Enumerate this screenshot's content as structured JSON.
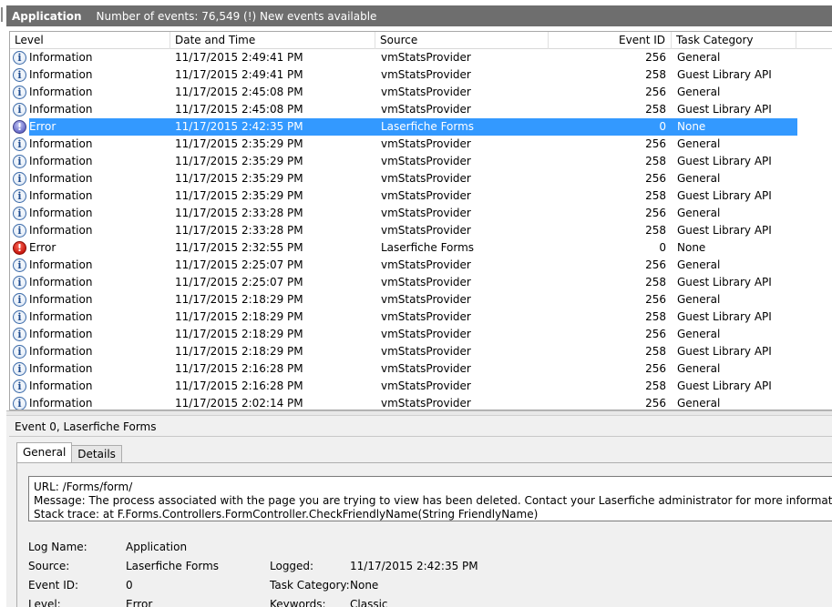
{
  "title": {
    "app": "Application",
    "info": "Number of events: 76,549 (!) New events available"
  },
  "columns": {
    "level": "Level",
    "date": "Date and Time",
    "source": "Source",
    "event_id": "Event ID",
    "task": "Task Category"
  },
  "rows": [
    {
      "level": "Information",
      "icon": "info-icon",
      "date": "11/17/2015 2:49:41 PM",
      "source": "vmStatsProvider",
      "id": "256",
      "task": "General"
    },
    {
      "level": "Information",
      "icon": "info-icon",
      "date": "11/17/2015 2:49:41 PM",
      "source": "vmStatsProvider",
      "id": "258",
      "task": "Guest Library API"
    },
    {
      "level": "Information",
      "icon": "info-icon",
      "date": "11/17/2015 2:45:08 PM",
      "source": "vmStatsProvider",
      "id": "256",
      "task": "General"
    },
    {
      "level": "Information",
      "icon": "info-icon",
      "date": "11/17/2015 2:45:08 PM",
      "source": "vmStatsProvider",
      "id": "258",
      "task": "Guest Library API"
    },
    {
      "level": "Error",
      "icon": "error-icon",
      "date": "11/17/2015 2:42:35 PM",
      "source": "Laserfiche Forms",
      "id": "0",
      "task": "None",
      "selected": true
    },
    {
      "level": "Information",
      "icon": "info-icon",
      "date": "11/17/2015 2:35:29 PM",
      "source": "vmStatsProvider",
      "id": "256",
      "task": "General"
    },
    {
      "level": "Information",
      "icon": "info-icon",
      "date": "11/17/2015 2:35:29 PM",
      "source": "vmStatsProvider",
      "id": "258",
      "task": "Guest Library API"
    },
    {
      "level": "Information",
      "icon": "info-icon",
      "date": "11/17/2015 2:35:29 PM",
      "source": "vmStatsProvider",
      "id": "256",
      "task": "General"
    },
    {
      "level": "Information",
      "icon": "info-icon",
      "date": "11/17/2015 2:35:29 PM",
      "source": "vmStatsProvider",
      "id": "258",
      "task": "Guest Library API"
    },
    {
      "level": "Information",
      "icon": "info-icon",
      "date": "11/17/2015 2:33:28 PM",
      "source": "vmStatsProvider",
      "id": "256",
      "task": "General"
    },
    {
      "level": "Information",
      "icon": "info-icon",
      "date": "11/17/2015 2:33:28 PM",
      "source": "vmStatsProvider",
      "id": "258",
      "task": "Guest Library API"
    },
    {
      "level": "Error",
      "icon": "error-icon",
      "date": "11/17/2015 2:32:55 PM",
      "source": "Laserfiche Forms",
      "id": "0",
      "task": "None"
    },
    {
      "level": "Information",
      "icon": "info-icon",
      "date": "11/17/2015 2:25:07 PM",
      "source": "vmStatsProvider",
      "id": "256",
      "task": "General"
    },
    {
      "level": "Information",
      "icon": "info-icon",
      "date": "11/17/2015 2:25:07 PM",
      "source": "vmStatsProvider",
      "id": "258",
      "task": "Guest Library API"
    },
    {
      "level": "Information",
      "icon": "info-icon",
      "date": "11/17/2015 2:18:29 PM",
      "source": "vmStatsProvider",
      "id": "256",
      "task": "General"
    },
    {
      "level": "Information",
      "icon": "info-icon",
      "date": "11/17/2015 2:18:29 PM",
      "source": "vmStatsProvider",
      "id": "258",
      "task": "Guest Library API"
    },
    {
      "level": "Information",
      "icon": "info-icon",
      "date": "11/17/2015 2:18:29 PM",
      "source": "vmStatsProvider",
      "id": "256",
      "task": "General"
    },
    {
      "level": "Information",
      "icon": "info-icon",
      "date": "11/17/2015 2:18:29 PM",
      "source": "vmStatsProvider",
      "id": "258",
      "task": "Guest Library API"
    },
    {
      "level": "Information",
      "icon": "info-icon",
      "date": "11/17/2015 2:16:28 PM",
      "source": "vmStatsProvider",
      "id": "256",
      "task": "General"
    },
    {
      "level": "Information",
      "icon": "info-icon",
      "date": "11/17/2015 2:16:28 PM",
      "source": "vmStatsProvider",
      "id": "258",
      "task": "Guest Library API"
    },
    {
      "level": "Information",
      "icon": "info-icon",
      "date": "11/17/2015 2:02:14 PM",
      "source": "vmStatsProvider",
      "id": "256",
      "task": "General"
    }
  ],
  "detail": {
    "title": "Event 0, Laserfiche Forms",
    "tabs": {
      "general": "General",
      "details": "Details"
    },
    "message_lines": [
      "URL: /Forms/form/",
      "Message: The process associated with the page you are trying to view has been deleted. Contact your Laserfiche administrator for more information.",
      "Stack trace:    at F.Forms.Controllers.FormController.CheckFriendlyName(String FriendlyName)"
    ],
    "props": {
      "log_name_label": "Log Name:",
      "log_name": "Application",
      "source_label": "Source:",
      "source": "Laserfiche Forms",
      "logged_label": "Logged:",
      "logged": "11/17/2015 2:42:35 PM",
      "event_id_label": "Event ID:",
      "event_id": "0",
      "task_label": "Task Category:",
      "task": "None",
      "level_label": "Level:",
      "level": "Error",
      "keywords_label": "Keywords:",
      "keywords": "Classic"
    }
  },
  "colors": {
    "titlebar": "#6e6e6e",
    "selection": "#3399ff",
    "panel": "#f0f0f0"
  }
}
